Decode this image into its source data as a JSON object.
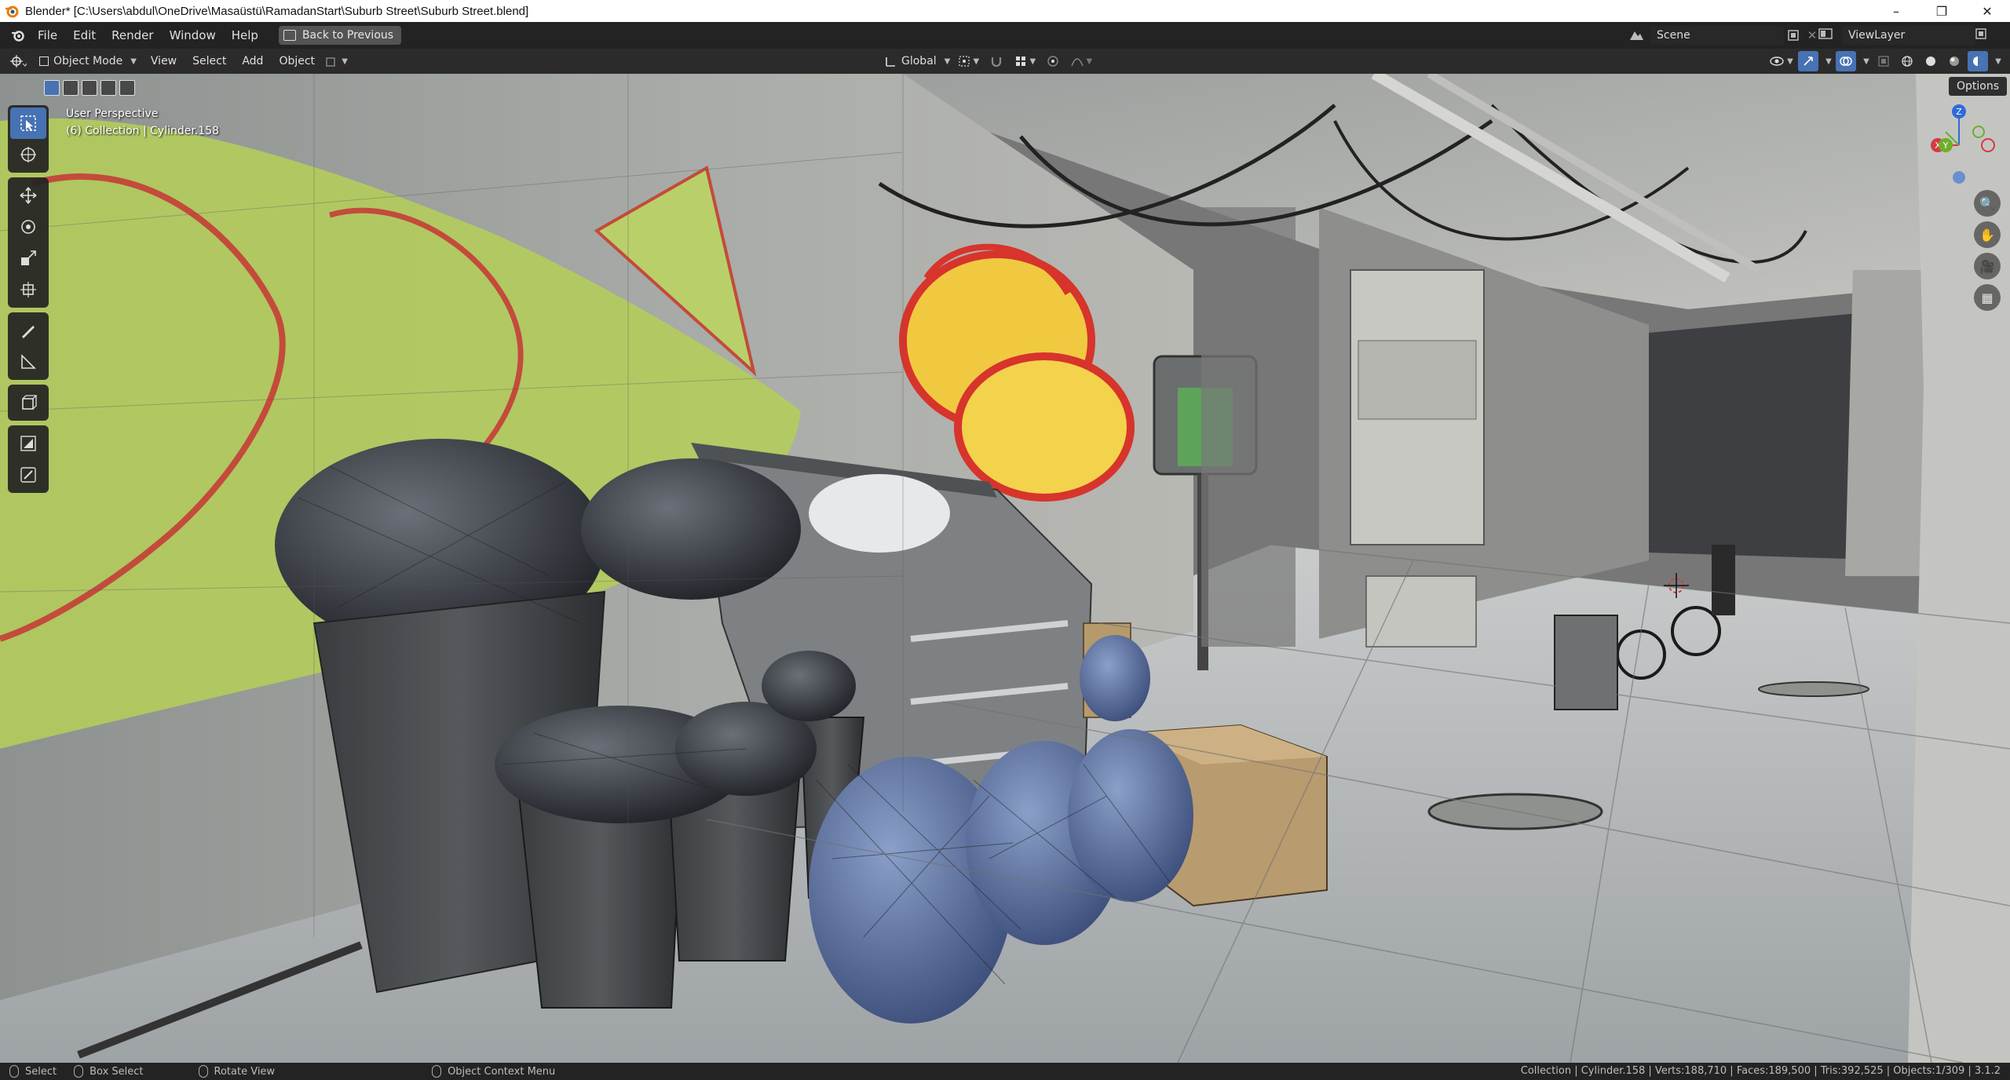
{
  "window": {
    "title": "Blender* [C:\\Users\\abdul\\OneDrive\\Masaüstü\\RamadanStart\\Suburb Street\\Suburb Street.blend]",
    "minimize": "–",
    "maximize": "❐",
    "close": "✕"
  },
  "topbar": {
    "menus": [
      "File",
      "Edit",
      "Render",
      "Window",
      "Help"
    ],
    "back_button": "Back to Previous",
    "scene": "Scene",
    "view_layer": "ViewLayer"
  },
  "viewport_header": {
    "mode": "Object Mode",
    "menus": [
      "View",
      "Select",
      "Add",
      "Object"
    ],
    "transform_orientation": "Global"
  },
  "viewport": {
    "perspective_label": "User Perspective",
    "collection_label": "(6) Collection | Cylinder.158",
    "options_label": "Options",
    "gizmo_axes": [
      "X",
      "Y",
      "Z"
    ]
  },
  "statusbar": {
    "items": [
      "Select",
      "Box Select",
      "Rotate View",
      "Object Context Menu"
    ],
    "stats": "Collection | Cylinder.158 | Verts:188,710 | Faces:189,500 | Tris:392,525 | Objects:1/309 | 3.1.2"
  },
  "colors": {
    "accent": "#4772b3",
    "header_bg": "#2b2b2b",
    "topbar_bg": "#232323"
  }
}
